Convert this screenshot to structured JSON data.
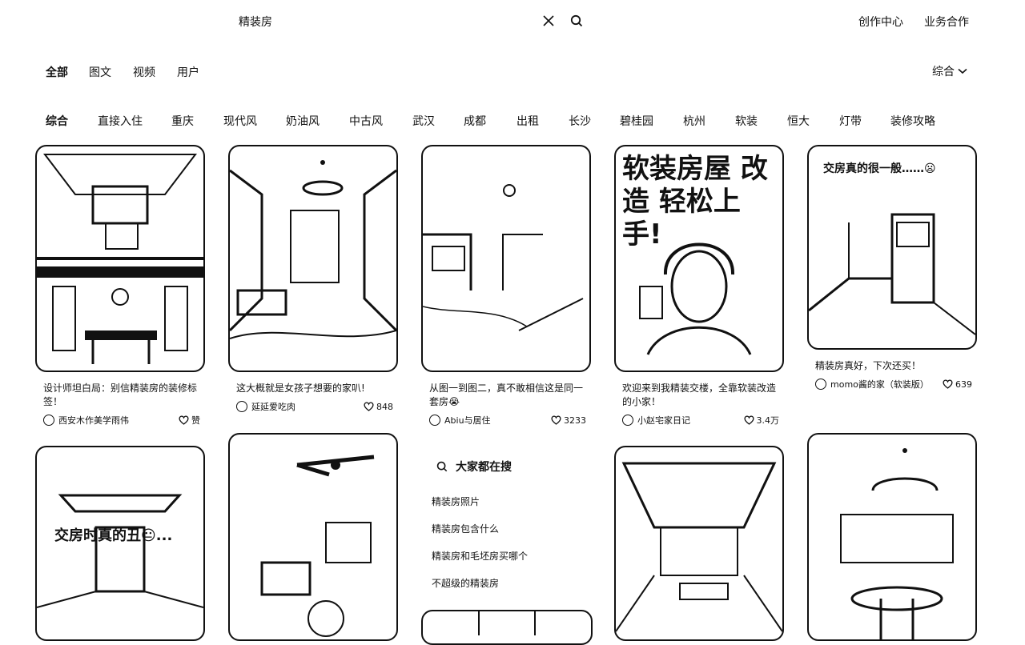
{
  "search": {
    "query": "精装房"
  },
  "header": {
    "creator_center": "创作中心",
    "business": "业务合作"
  },
  "type_tabs": [
    "全部",
    "图文",
    "视频",
    "用户"
  ],
  "sort": {
    "label": "综合"
  },
  "chips": [
    "综合",
    "直接入住",
    "重庆",
    "现代风",
    "奶油风",
    "中古风",
    "武汉",
    "成都",
    "出租",
    "长沙",
    "碧桂园",
    "杭州",
    "软装",
    "恒大",
    "灯带",
    "装修攻略"
  ],
  "cards": [
    {
      "title": "设计师坦白局：别信精装房的装修标签！",
      "author": "西安木作美学雨伟",
      "likes": "赞",
      "overlay": ""
    },
    {
      "title": "这大概就是女孩子想要的家叭!",
      "author": "延延爱吃肉",
      "likes": "848",
      "overlay": ""
    },
    {
      "title": "从图一到图二，真不敢相信这是同一套房😭",
      "author": "Abiu与居住",
      "likes": "3233",
      "overlay": ""
    },
    {
      "title": "欢迎来到我精装交楼，全靠软装改造的小家！",
      "author": "小赵宅家日记",
      "likes": "3.4万",
      "overlay": "软装房屋 改造 轻松上手!"
    },
    {
      "title": "精装房真好，下次还买！",
      "author": "momo酱的家（软装版）",
      "likes": "639",
      "overlay": "交房真的很一般……😦"
    },
    {
      "title": "",
      "author": "",
      "likes": "",
      "overlay": "交房时真的丑😐..."
    },
    {
      "title": "",
      "author": "",
      "likes": "",
      "overlay": ""
    },
    {
      "title": "",
      "author": "",
      "likes": "",
      "overlay": ""
    },
    {
      "title": "",
      "author": "",
      "likes": "",
      "overlay": ""
    }
  ],
  "suggestions": {
    "heading": "大家都在搜",
    "items": [
      "精装房照片",
      "精装房包含什么",
      "精装房和毛坯房买哪个",
      "不超级的精装房"
    ]
  }
}
